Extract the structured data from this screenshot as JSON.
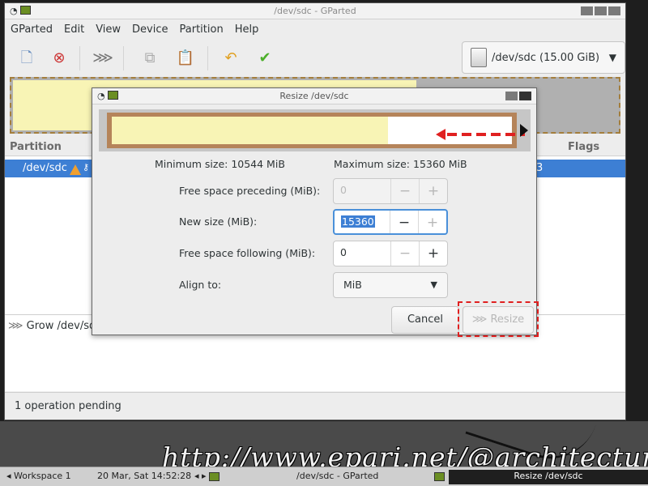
{
  "window": {
    "title": "/dev/sdc - GParted"
  },
  "menu": [
    "GParted",
    "Edit",
    "View",
    "Device",
    "Partition",
    "Help"
  ],
  "toolbar": {
    "icons": [
      "new-icon",
      "delete-icon",
      "resize-move-icon",
      "copy-icon",
      "paste-icon",
      "undo-icon",
      "apply-icon"
    ],
    "device": "/dev/sdc (15.00 GiB)"
  },
  "table": {
    "headers": {
      "partition": "Partition",
      "flags": "Flags"
    },
    "row": {
      "partition": "/dev/sdc",
      "flags_fragment": "3"
    }
  },
  "operations": {
    "item": "Grow /dev/sdc"
  },
  "status": "1 operation pending",
  "dialog": {
    "title": "Resize /dev/sdc",
    "min_size": "Minimum size: 10544 MiB",
    "max_size": "Maximum size: 15360 MiB",
    "usage_fraction": 0.69,
    "fields": {
      "free_preceding": {
        "label": "Free space preceding (MiB):",
        "value": "0"
      },
      "new_size": {
        "label": "New size (MiB):",
        "value": "15360"
      },
      "free_following": {
        "label": "Free space following (MiB):",
        "value": "0"
      },
      "align": {
        "label": "Align to:",
        "value": "MiB"
      }
    },
    "cancel": "Cancel",
    "resize": "Resize"
  },
  "taskbar": {
    "workspace": "Workspace 1",
    "clock": "20 Mar, Sat 14:52:28",
    "task1": "/dev/sdc - GParted",
    "task2": "Resize /dev/sdc"
  },
  "watermark": "http://www.epari.net/@architecture",
  "colors": {
    "selection": "#3d7fd4",
    "partition_fill": "#f8f4b5",
    "partition_border": "#b5845a",
    "annotation": "#e02020"
  }
}
